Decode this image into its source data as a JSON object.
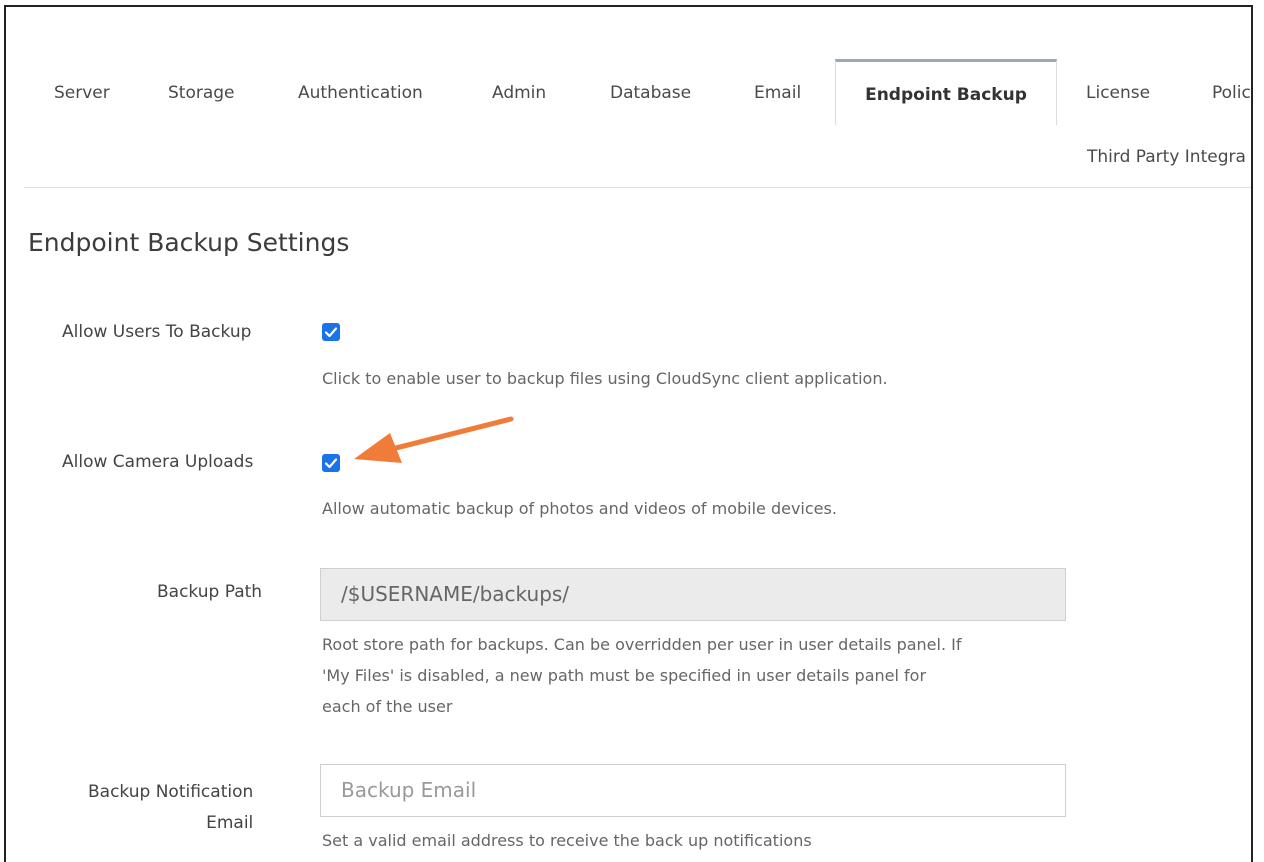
{
  "tabs": [
    {
      "label": "Server"
    },
    {
      "label": "Storage"
    },
    {
      "label": "Authentication"
    },
    {
      "label": "Admin"
    },
    {
      "label": "Database"
    },
    {
      "label": "Email"
    },
    {
      "label": "Endpoint Backup",
      "active": true
    },
    {
      "label": "License"
    },
    {
      "label": "Polici"
    },
    {
      "label": "Third Party Integra"
    }
  ],
  "section_title": "Endpoint Backup Settings",
  "settings": {
    "allow_users_backup": {
      "label": "Allow Users To Backup",
      "checked": true,
      "help": "Click to enable user to backup files using CloudSync client application."
    },
    "allow_camera_uploads": {
      "label": "Allow Camera Uploads",
      "checked": true,
      "help": "Allow automatic backup of photos and videos of mobile devices."
    },
    "backup_path": {
      "label": "Backup Path",
      "value": "/$USERNAME/backups/",
      "help_lines": [
        "Root store path for backups. Can be overridden per user in user details panel. If",
        "'My Files' is disabled, a new path must be specified in user details panel for",
        "each of the user"
      ]
    },
    "backup_notification_email": {
      "label_lines": [
        "Backup Notification",
        "Email"
      ],
      "placeholder": "Backup Email",
      "value": "",
      "help": "Set a valid email address to receive the back up notifications"
    }
  },
  "annotation": {
    "arrow_color": "#f07c3a"
  },
  "colors": {
    "checkbox": "#1a73e8",
    "active_tab_border": "#9aaab3"
  }
}
